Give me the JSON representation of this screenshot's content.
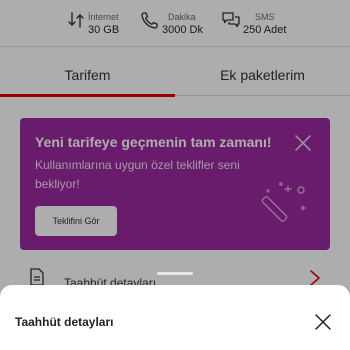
{
  "usage": {
    "internet": {
      "label": "İnternet",
      "value": "30 GB",
      "icon": "data-transfer-icon"
    },
    "calls": {
      "label": "Dakika",
      "value": "3000 Dk",
      "icon": "phone-icon"
    },
    "sms": {
      "label": "SMS",
      "value": "250 Adet",
      "icon": "chat-icon"
    }
  },
  "tabs": [
    {
      "label": "Tarifem",
      "active": true
    },
    {
      "label": "Ek paketlerim",
      "active": false
    }
  ],
  "promo": {
    "title": "Yeni tarifeye geçmenin tam zamanı!",
    "description": "Kullanımlarına uygun özel teklifler seni bekliyor!",
    "button_label": "Teklifini Gör",
    "background_color": "#9c2aa0"
  },
  "commitment_row": {
    "label": "Taahhüt detayları"
  },
  "sheet": {
    "title": "Taahhüt detayları"
  },
  "colors": {
    "accent": "#e60000",
    "promo": "#9c2aa0"
  }
}
